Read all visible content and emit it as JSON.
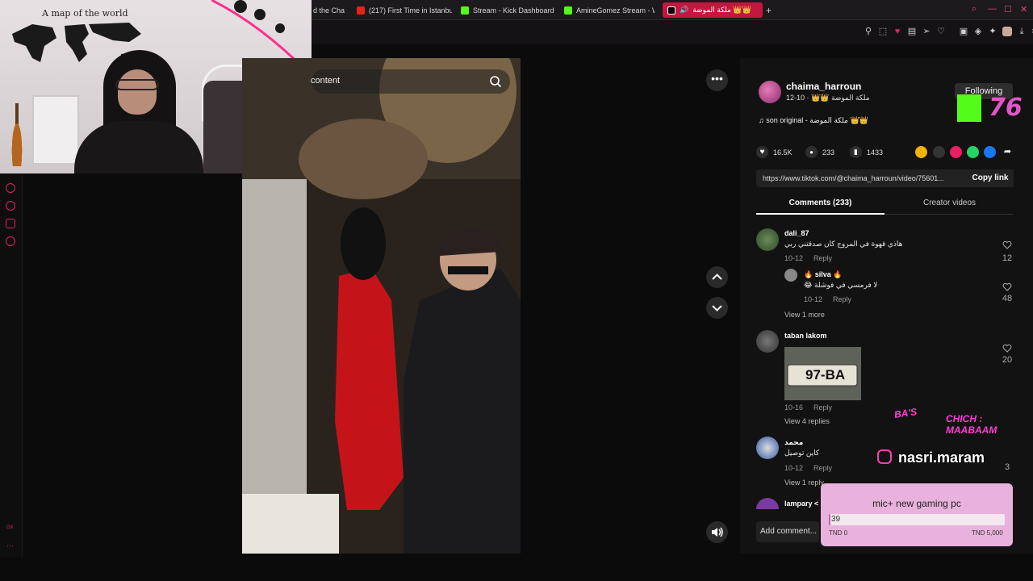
{
  "colors": {
    "accent": "#e0245e",
    "kick_green": "#53fc18",
    "goal_bg": "#e8b2dc",
    "goal_fill": "#b968b1"
  },
  "browser": {
    "tabs": [
      {
        "label": "d the Cha",
        "icon": "pink-icon"
      },
      {
        "label": "(217) First Time in Istanbu",
        "icon": "youtube-icon"
      },
      {
        "label": "Stream - Kick Dashboard",
        "icon": "kick-icon"
      },
      {
        "label": "AmineGomez Stream - W",
        "icon": "kick-icon"
      },
      {
        "label": "ملكة الموضة 👑👑",
        "icon": "tiktok-icon",
        "active": true
      }
    ],
    "new_tab": "+"
  },
  "webcam": {
    "map_title": "A map of the world"
  },
  "sidebar": {
    "bottom_label": "GX",
    "dots": "···"
  },
  "video": {
    "search_text": "content",
    "more": "•••"
  },
  "post": {
    "username": "chaima_harroun",
    "subline": "ملكة الموضة 👑👑 · 10-12",
    "follow_label": "Following",
    "sound": "♫ son original - ملكة الموضة 👑👑",
    "likes": "16.5K",
    "comments": "233",
    "saves": "1433",
    "url": "https://www.tiktok.com/@chaima_harroun/video/75601...",
    "copy_link": "Copy link",
    "tab_comments": "Comments (233)",
    "tab_creator": "Creator videos",
    "add_comment": "Add comment..."
  },
  "comments": [
    {
      "name": "dali_87",
      "text": "هاذي قهوة في المروج كان صدقتني ربي",
      "date": "10-12",
      "reply": "Reply",
      "likes": "12"
    },
    {
      "name": "🔥 silva 🔥",
      "text": "😂 لا فرمسي في فوشلة",
      "date": "10-12",
      "reply": "Reply",
      "likes": "48"
    },
    {
      "name": "taban lakom",
      "date": "10-16",
      "reply": "Reply",
      "likes": "20",
      "thumb_text": "97-BA"
    },
    {
      "name": "محمد",
      "text": "كاين توصيل",
      "date": "10-12",
      "reply": "Reply",
      "likes": "3"
    },
    {
      "name": "lampary <"
    }
  ],
  "view_more": "View 1 more",
  "view_4_replies": "View 4 replies",
  "view_1_reply": "View 1 reply",
  "overlay": {
    "kick_number": "76",
    "tag1": "BA'S",
    "tag2": "CHICH : MAABAAM",
    "instagram": "nasri.maram",
    "goal_title": "mic+ new gaming pc",
    "goal_value": "39",
    "goal_fraction": 0.008,
    "goal_min": "TND 0",
    "goal_max": "TND 5,000"
  }
}
